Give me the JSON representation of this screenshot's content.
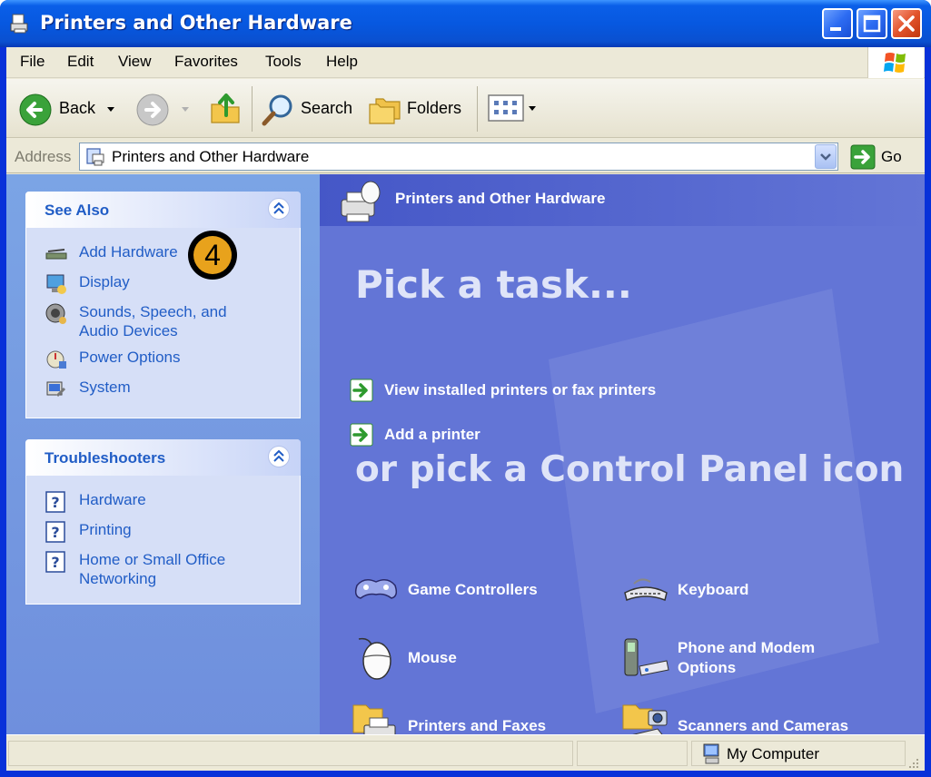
{
  "window": {
    "title": "Printers and Other Hardware"
  },
  "menu": {
    "items": [
      "File",
      "Edit",
      "View",
      "Favorites",
      "Tools",
      "Help"
    ]
  },
  "toolbar": {
    "back_label": "Back",
    "search_label": "Search",
    "folders_label": "Folders"
  },
  "address": {
    "label": "Address",
    "value": "Printers and Other Hardware",
    "go_label": "Go"
  },
  "see_also": {
    "title": "See Also",
    "items": [
      {
        "label": "Add Hardware",
        "icon": "add-hardware-icon"
      },
      {
        "label": "Display",
        "icon": "display-icon"
      },
      {
        "label": "Sounds, Speech, and\nAudio Devices",
        "icon": "sounds-icon"
      },
      {
        "label": "Power Options",
        "icon": "power-icon"
      },
      {
        "label": "System",
        "icon": "system-icon"
      }
    ]
  },
  "troubleshooters": {
    "title": "Troubleshooters",
    "items": [
      {
        "label": "Hardware",
        "icon": "help-icon"
      },
      {
        "label": "Printing",
        "icon": "help-icon"
      },
      {
        "label": "Home or Small Office\nNetworking",
        "icon": "help-icon"
      }
    ]
  },
  "callout": {
    "number": "4"
  },
  "main": {
    "header_title": "Printers and Other Hardware",
    "pick_task": "Pick a task...",
    "tasks": [
      "View installed printers or fax printers",
      "Add a printer"
    ],
    "pick_icon": "or pick a Control Panel icon",
    "icons": [
      {
        "label": "Game Controllers",
        "icon": "game-controller-icon"
      },
      {
        "label": "Keyboard",
        "icon": "keyboard-icon"
      },
      {
        "label": "Mouse",
        "icon": "mouse-icon"
      },
      {
        "label": "Phone and Modem\nOptions",
        "icon": "phone-modem-icon"
      },
      {
        "label": "Printers and Faxes",
        "icon": "printer-fax-icon"
      },
      {
        "label": "Scanners and Cameras",
        "icon": "scanner-camera-icon"
      }
    ]
  },
  "status": {
    "location": "My Computer"
  },
  "colors": {
    "title_blue": "#0a5fe8",
    "task_pane_blue": "#6f8fdd",
    "content_blue": "#6375d6",
    "link_blue": "#215dc6",
    "close_red": "#e2532b",
    "callout_gold": "#e8a21c"
  }
}
